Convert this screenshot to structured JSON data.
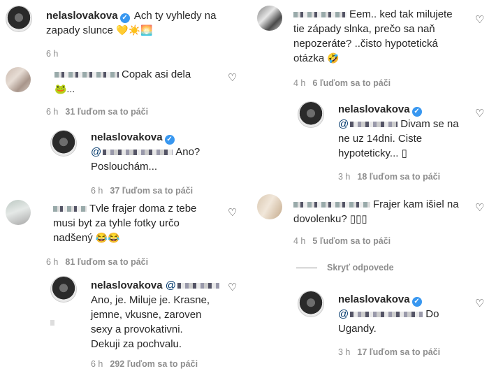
{
  "left": {
    "c1": {
      "user": "nelaslovakova",
      "text": "Ach ty vyhledy na zapady slunce",
      "emoji": "💛☀️🌅",
      "time": "6 h"
    },
    "c2": {
      "text": "Copak asi dela",
      "emoji": "🐸...",
      "time": "6 h",
      "likes": "31 ľuďom sa to páči"
    },
    "r1": {
      "user": "nelaslovakova",
      "text1": "Ano?",
      "text2": "Poslouchám...",
      "time": "6 h",
      "likes": "37 ľuďom sa to páči"
    },
    "c3": {
      "line1": "Tvle frajer doma z tebe",
      "line2": "musi byt za tyhle fotky určo",
      "line3": "nadšený",
      "emoji": "😂😂",
      "time": "6 h",
      "likes": "81 ľuďom sa to páči"
    },
    "r2": {
      "user": "nelaslovakova",
      "line1": "Ano, je. Miluje je. Krasne,",
      "line2": "jemne, vkusne, zaroven",
      "line3": "sexy a provokativni.",
      "line4": "Dekuji za pochvalu.",
      "time": "6 h",
      "likes": "292 ľuďom sa to páči"
    }
  },
  "right": {
    "c1": {
      "line1": "Eem.. ked tak milujete",
      "line2": "tie západy slnka, prečo sa naň",
      "line3": "nepozeráte? ..čisto hypotetická",
      "line4": "otázka",
      "emoji": "🤣",
      "time": "4 h",
      "likes": "6 ľuďom sa to páči"
    },
    "r1": {
      "user": "nelaslovakova",
      "line1": "Divam se na",
      "line2": "ne uz 14dni. Ciste",
      "line3": "hypoteticky... ▯",
      "time": "3 h",
      "likes": "18 ľuďom sa to páči"
    },
    "c2": {
      "line1": "Frajer kam išiel na",
      "line2": "dovolenku? ▯▯▯",
      "time": "4 h",
      "likes": "5 ľuďom sa to páči"
    },
    "hide_replies": "Skryť odpovede",
    "r2": {
      "user": "nelaslovakova",
      "line1": "Do",
      "line2": "Ugandy.",
      "time": "3 h",
      "likes": "17 ľuďom sa to páči"
    }
  },
  "icons": {
    "heart": "heart-icon",
    "verified": "verified-badge-icon"
  },
  "colors": {
    "text": "#262626",
    "meta": "#8e8e8e",
    "verified": "#3897f0"
  }
}
